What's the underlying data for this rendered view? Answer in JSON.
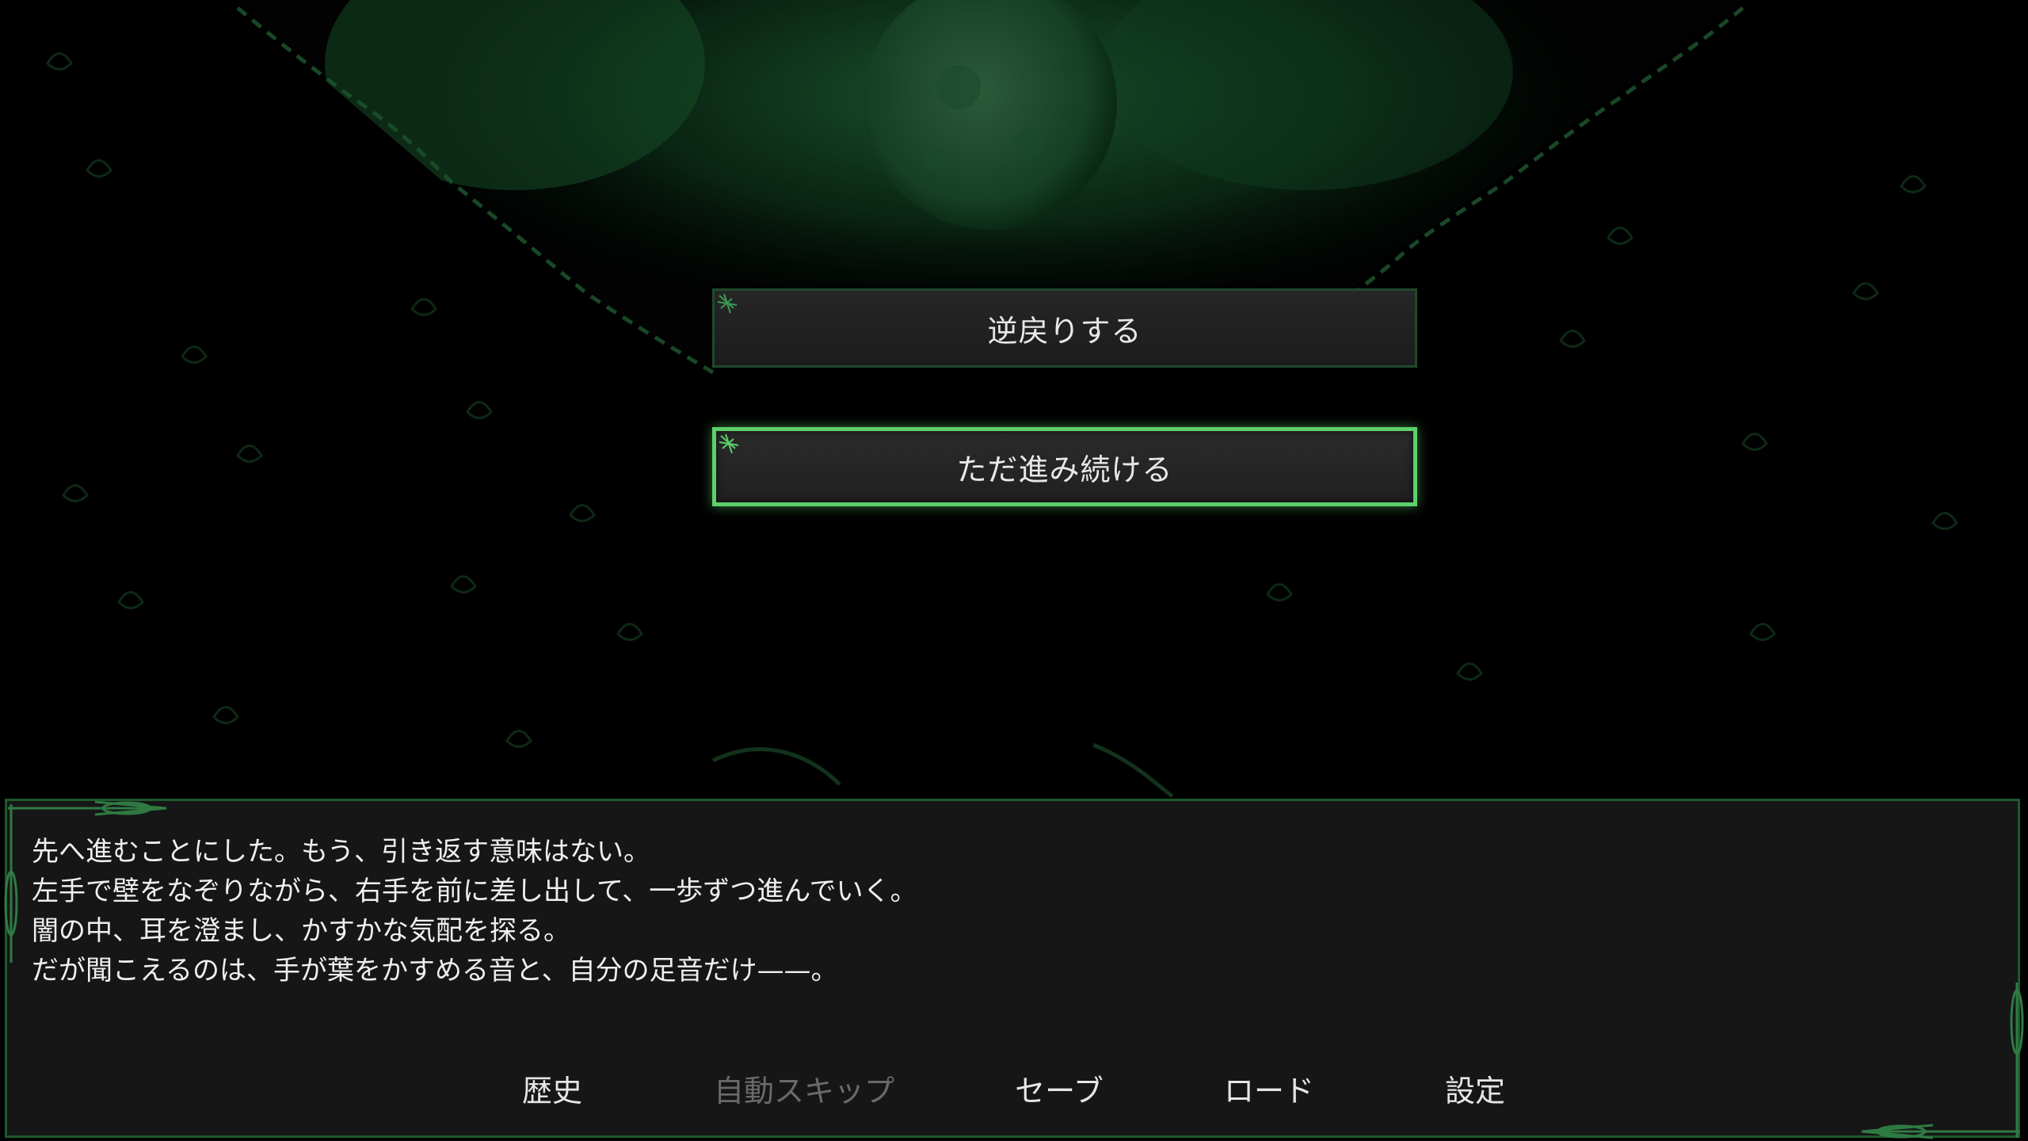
{
  "choices": [
    {
      "label": "逆戻りする",
      "selected": false
    },
    {
      "label": "ただ進み続ける",
      "selected": true
    }
  ],
  "dialogue": {
    "lines": [
      "先へ進むことにした。もう、引き返す意味はない。",
      "左手で壁をなぞりながら、右手を前に差し出して、一歩ずつ進んでいく。",
      "闇の中、耳を澄まし、かすかな気配を探る。",
      "だが聞こえるのは、手が葉をかすめる音と、自分の足音だけ——。"
    ]
  },
  "menu": {
    "history": "歴史",
    "auto_skip": "自動スキップ",
    "save": "セーブ",
    "load": "ロード",
    "settings": "設定"
  },
  "colors": {
    "accent": "#5cd06b",
    "frame": "#1d5a2c",
    "textbox": "#161616",
    "background": "#010201",
    "disabled": "#6a6a6a"
  }
}
